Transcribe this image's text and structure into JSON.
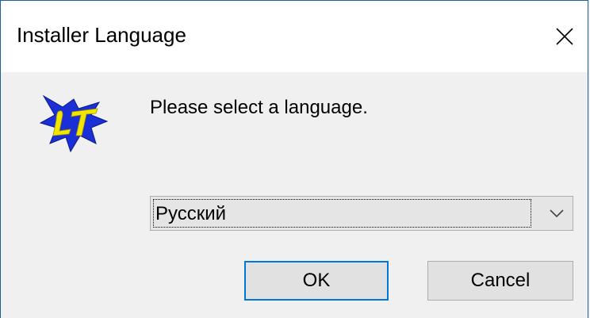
{
  "window": {
    "title": "Installer Language"
  },
  "dialog": {
    "prompt": "Please select a language.",
    "logo_icon": "lt-logo-icon",
    "language_select": {
      "selected": "Русский"
    },
    "ok_label": "OK",
    "cancel_label": "Cancel"
  },
  "colors": {
    "accent": "#0078d7",
    "titlebar_bg": "#ffffff",
    "dialog_bg": "#f0f0f0",
    "logo_blue": "#1a2fd6",
    "logo_yellow": "#f2e600"
  }
}
